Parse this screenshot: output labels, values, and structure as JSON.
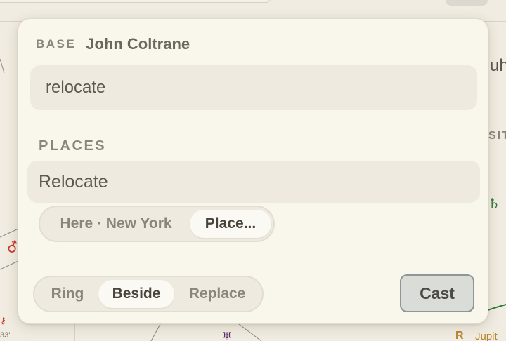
{
  "popover": {
    "base_label": "BASE",
    "base_name": "John Coltrane",
    "search_value": "relocate",
    "section_label": "PLACES",
    "result_label": "Relocate",
    "place_options": [
      "Here · New York",
      "Place..."
    ],
    "place_selected": "Place...",
    "mode_options": [
      "Ring",
      "Beside",
      "Replace"
    ],
    "mode_selected": "Beside",
    "cast_label": "Cast"
  },
  "background": {
    "right_text_top": "uh",
    "right_text_section": "SIT",
    "right_bottom_label": "Jupit",
    "retrograde_symbol": "R",
    "left_degree": "33'"
  },
  "colors": {
    "popover_bg": "#f9f6ec",
    "field_bg": "#efeadf",
    "cast_border": "#8d979a",
    "glyph_red": "#c8352a",
    "glyph_green": "#2f7d3a",
    "glyph_purple": "#5a2a6a",
    "glyph_gold": "#b8842a"
  }
}
